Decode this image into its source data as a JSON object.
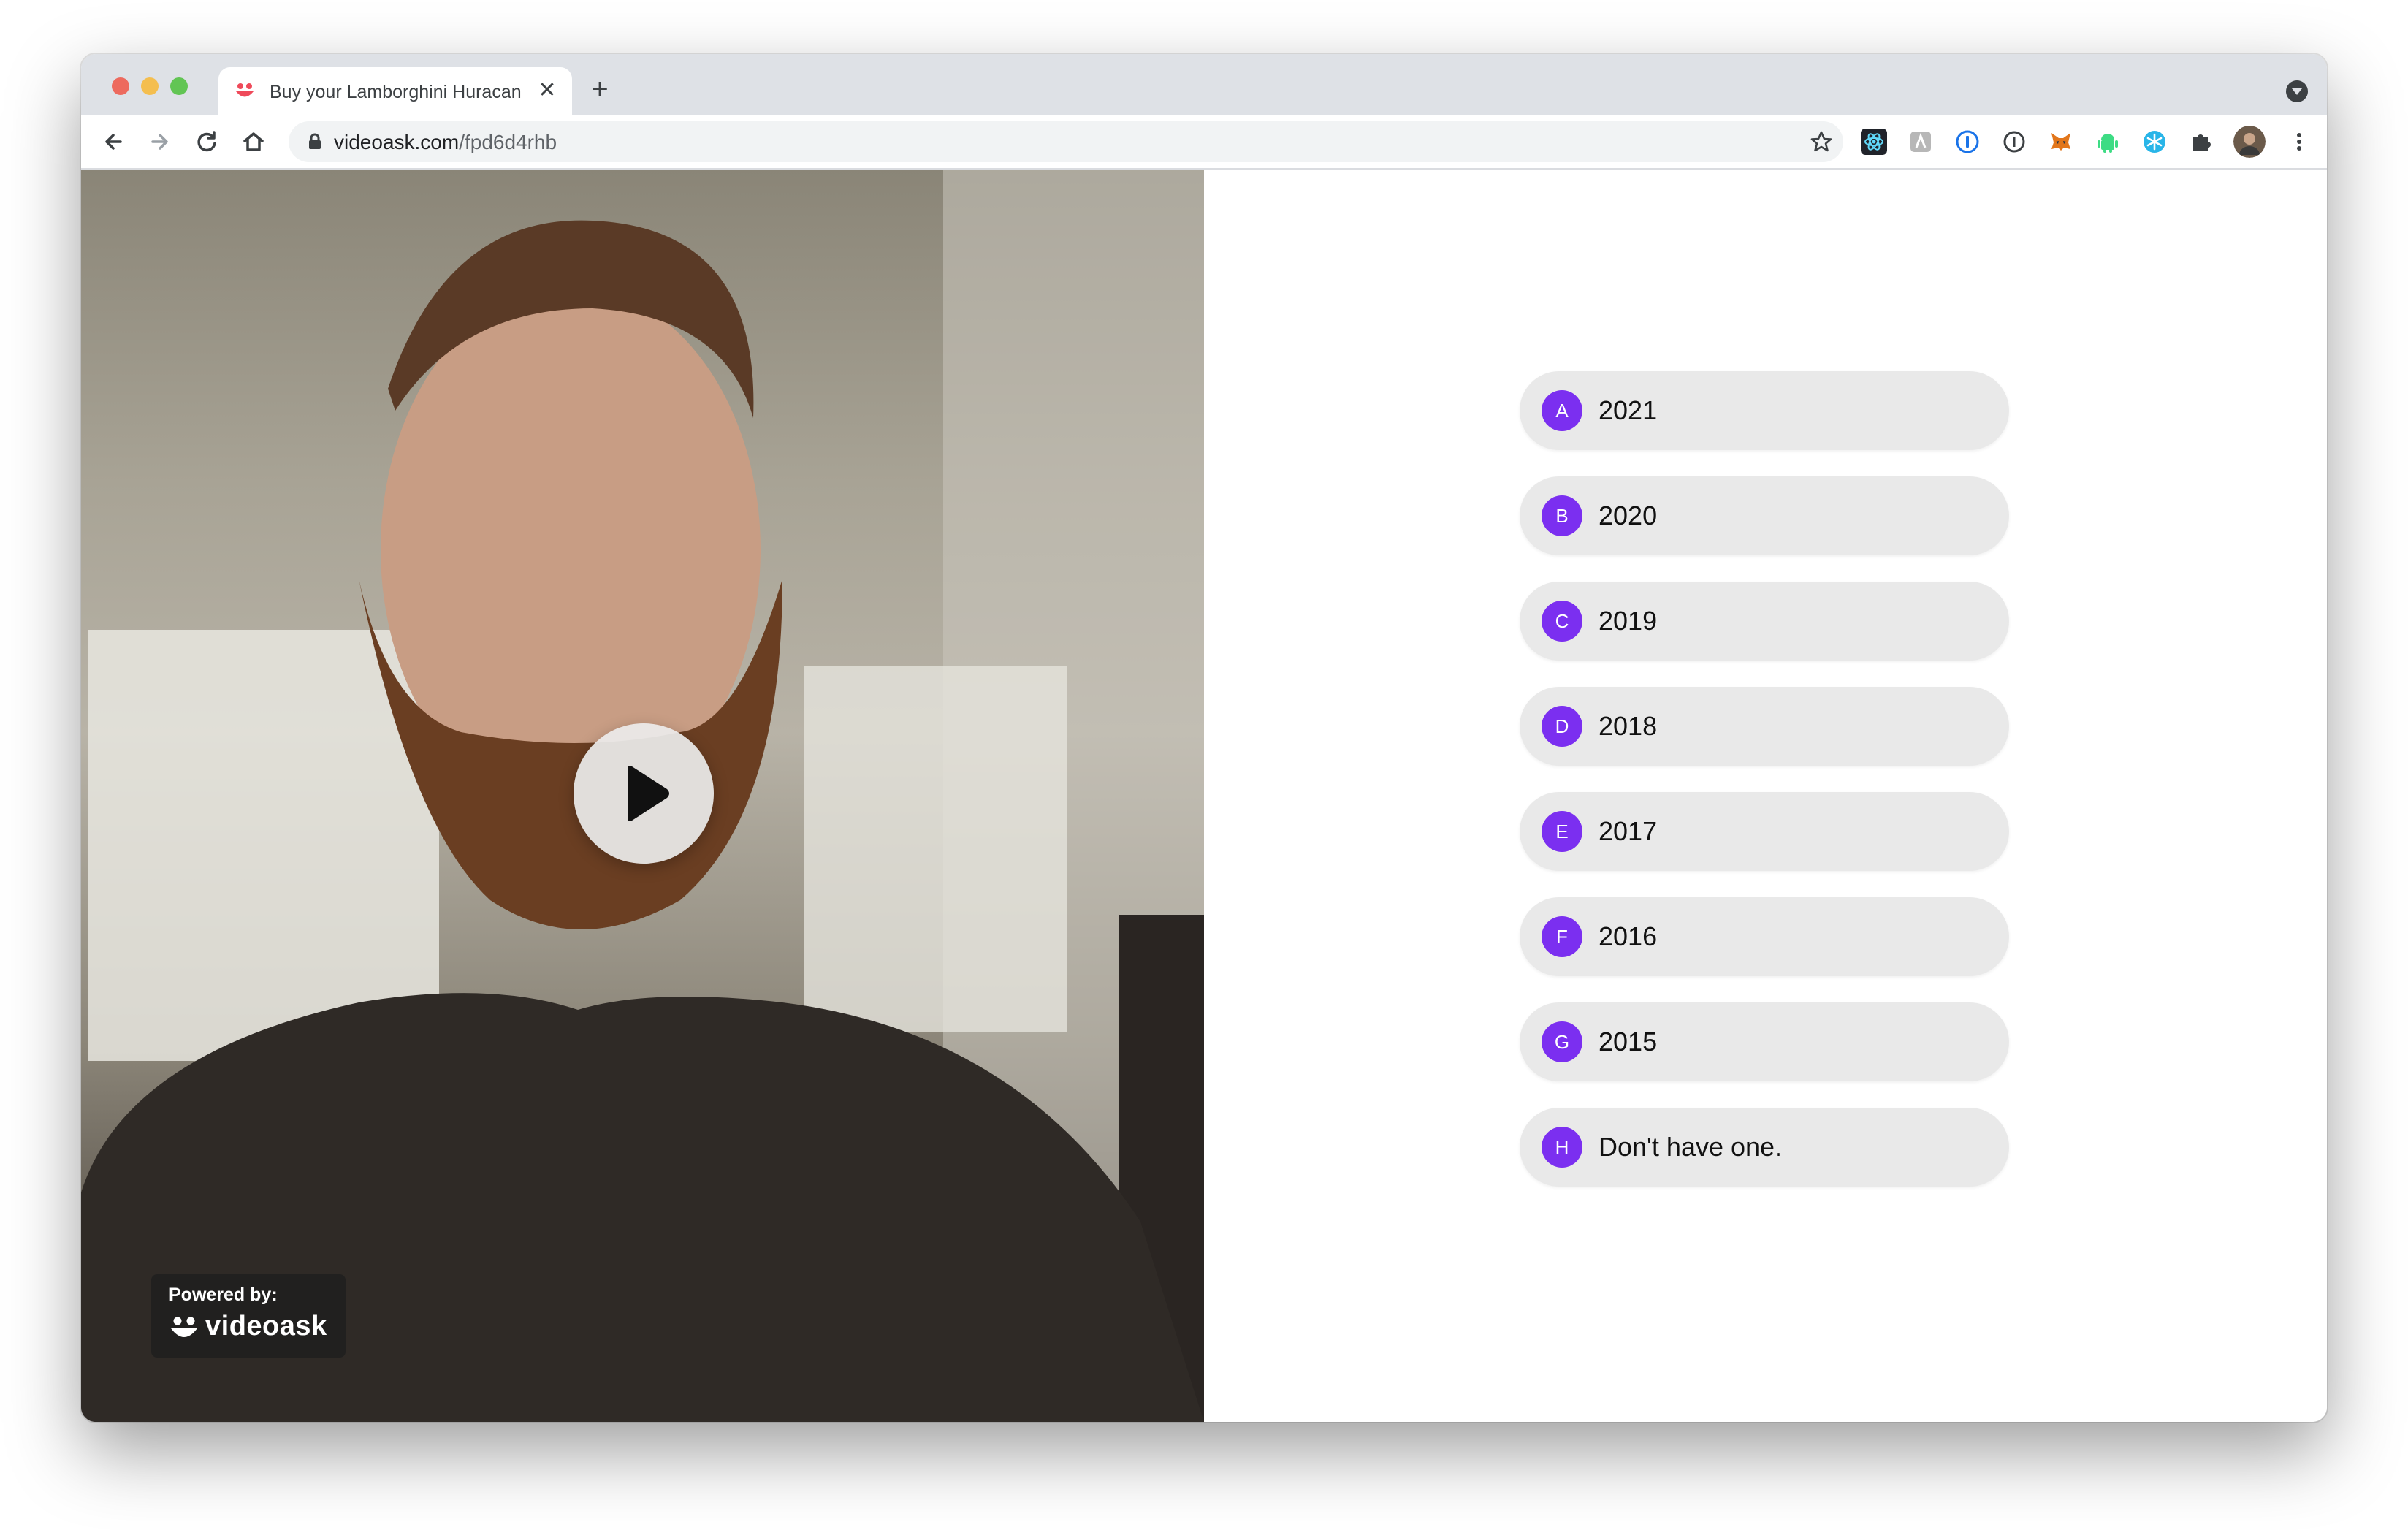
{
  "browser": {
    "tab": {
      "title": "Buy your Lamborghini Huracan",
      "close_glyph": "✕"
    },
    "new_tab_glyph": "+",
    "address_bar": {
      "domain": "videoask.com",
      "path": "/fpd6d4rhb"
    },
    "nav_icons": [
      "back-arrow-icon",
      "forward-arrow-icon",
      "reload-icon",
      "home-icon"
    ],
    "extension_icons": [
      "react-devtools-icon",
      "readability-icon",
      "onepassword-icon",
      "info-icon",
      "metamask-icon",
      "android-icon",
      "snowflake-icon",
      "puzzle-icon",
      "profile-avatar",
      "kebab-menu-icon"
    ],
    "colors": {
      "tab_strip": "#dee1e6",
      "omnibox": "#f1f3f4"
    }
  },
  "video": {
    "play_icon": "play-icon",
    "powered_by": {
      "label": "Powered by:",
      "brand": "videoask"
    }
  },
  "choices": [
    {
      "key": "A",
      "label": "2021"
    },
    {
      "key": "B",
      "label": "2020"
    },
    {
      "key": "C",
      "label": "2019"
    },
    {
      "key": "D",
      "label": "2018"
    },
    {
      "key": "E",
      "label": "2017"
    },
    {
      "key": "F",
      "label": "2016"
    },
    {
      "key": "G",
      "label": "2015"
    },
    {
      "key": "H",
      "label": "Don't have one."
    }
  ],
  "colors": {
    "accent": "#7b2ff0",
    "choice_background": "#e9e9e9"
  }
}
